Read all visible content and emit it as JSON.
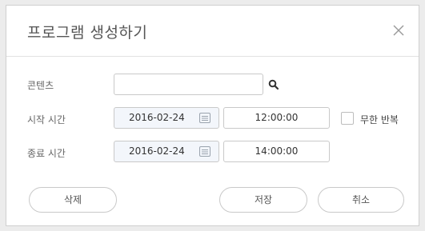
{
  "dialog": {
    "title": "프로그램 생성하기"
  },
  "form": {
    "content_label": "콘텐츠",
    "content_value": "",
    "start_label": "시작 시간",
    "start_date": "2016-02-24",
    "start_time": "12:00:00",
    "end_label": "종료 시간",
    "end_date": "2016-02-24",
    "end_time": "14:00:00",
    "repeat_label": "무한 반복",
    "repeat_checked": false
  },
  "buttons": {
    "delete": "삭제",
    "save": "저장",
    "cancel": "취소"
  },
  "icons": {
    "close": "close-icon",
    "search": "search-icon",
    "calendar": "calendar-icon"
  },
  "colors": {
    "date_field_bg": "#f3f6fb",
    "border": "#c9c9c9",
    "title_text": "#555555"
  }
}
